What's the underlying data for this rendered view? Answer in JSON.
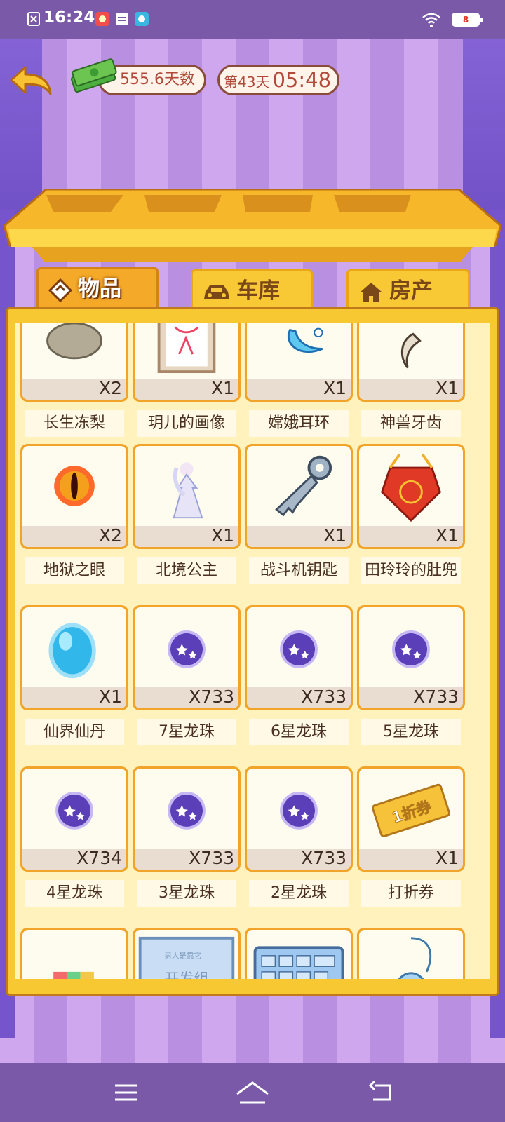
{
  "status_bar": {
    "time": "16:24",
    "battery": "8"
  },
  "top": {
    "money": "555.6天数",
    "day": "第43天",
    "clock": "05:48"
  },
  "tabs": [
    {
      "label": "物品",
      "icon": "diamond-icon"
    },
    {
      "label": "车库",
      "icon": "car-icon"
    },
    {
      "label": "房产",
      "icon": "house-icon"
    }
  ],
  "items": [
    {
      "name": "长生冻梨",
      "qty": "X2",
      "icon": "frozen-pear-icon"
    },
    {
      "name": "玥儿的画像",
      "qty": "X1",
      "icon": "portrait-icon"
    },
    {
      "name": "嫦娥耳环",
      "qty": "X1",
      "icon": "earring-icon"
    },
    {
      "name": "神兽牙齿",
      "qty": "X1",
      "icon": "beast-tooth-icon"
    },
    {
      "name": "地狱之眼",
      "qty": "X2",
      "icon": "hell-eye-icon"
    },
    {
      "name": "北境公主",
      "qty": "X1",
      "icon": "princess-icon"
    },
    {
      "name": "战斗机钥匙",
      "qty": "X1",
      "icon": "fighter-key-icon"
    },
    {
      "name": "田玲玲的肚兜",
      "qty": "X1",
      "icon": "dudou-icon"
    },
    {
      "name": "仙界仙丹",
      "qty": "X1",
      "icon": "elixir-icon"
    },
    {
      "name": "7星龙珠",
      "qty": "X733",
      "icon": "dragon-ball-icon"
    },
    {
      "name": "6星龙珠",
      "qty": "X733",
      "icon": "dragon-ball-icon"
    },
    {
      "name": "5星龙珠",
      "qty": "X733",
      "icon": "dragon-ball-icon"
    },
    {
      "name": "4星龙珠",
      "qty": "X734",
      "icon": "dragon-ball-icon"
    },
    {
      "name": "3星龙珠",
      "qty": "X733",
      "icon": "dragon-ball-icon"
    },
    {
      "name": "2星龙珠",
      "qty": "X733",
      "icon": "dragon-ball-icon"
    },
    {
      "name": "打折券",
      "qty": "X1",
      "icon": "coupon-icon"
    },
    {
      "name": "",
      "qty": "",
      "icon": "cube-block-icon"
    },
    {
      "name": "",
      "qty": "",
      "icon": "monitor-icon"
    },
    {
      "name": "",
      "qty": "",
      "icon": "keyboard-icon"
    },
    {
      "name": "",
      "qty": "",
      "icon": "mouse-icon"
    }
  ],
  "coupon_text": "1折券",
  "monitor_text": "开发组",
  "monitor_subtext": "男人是靠它",
  "colors": {
    "panel": "#f8c832",
    "card_border": "#f1a42a",
    "qty_strip": "#e9ddd1",
    "tab_active": "#f4a928"
  }
}
